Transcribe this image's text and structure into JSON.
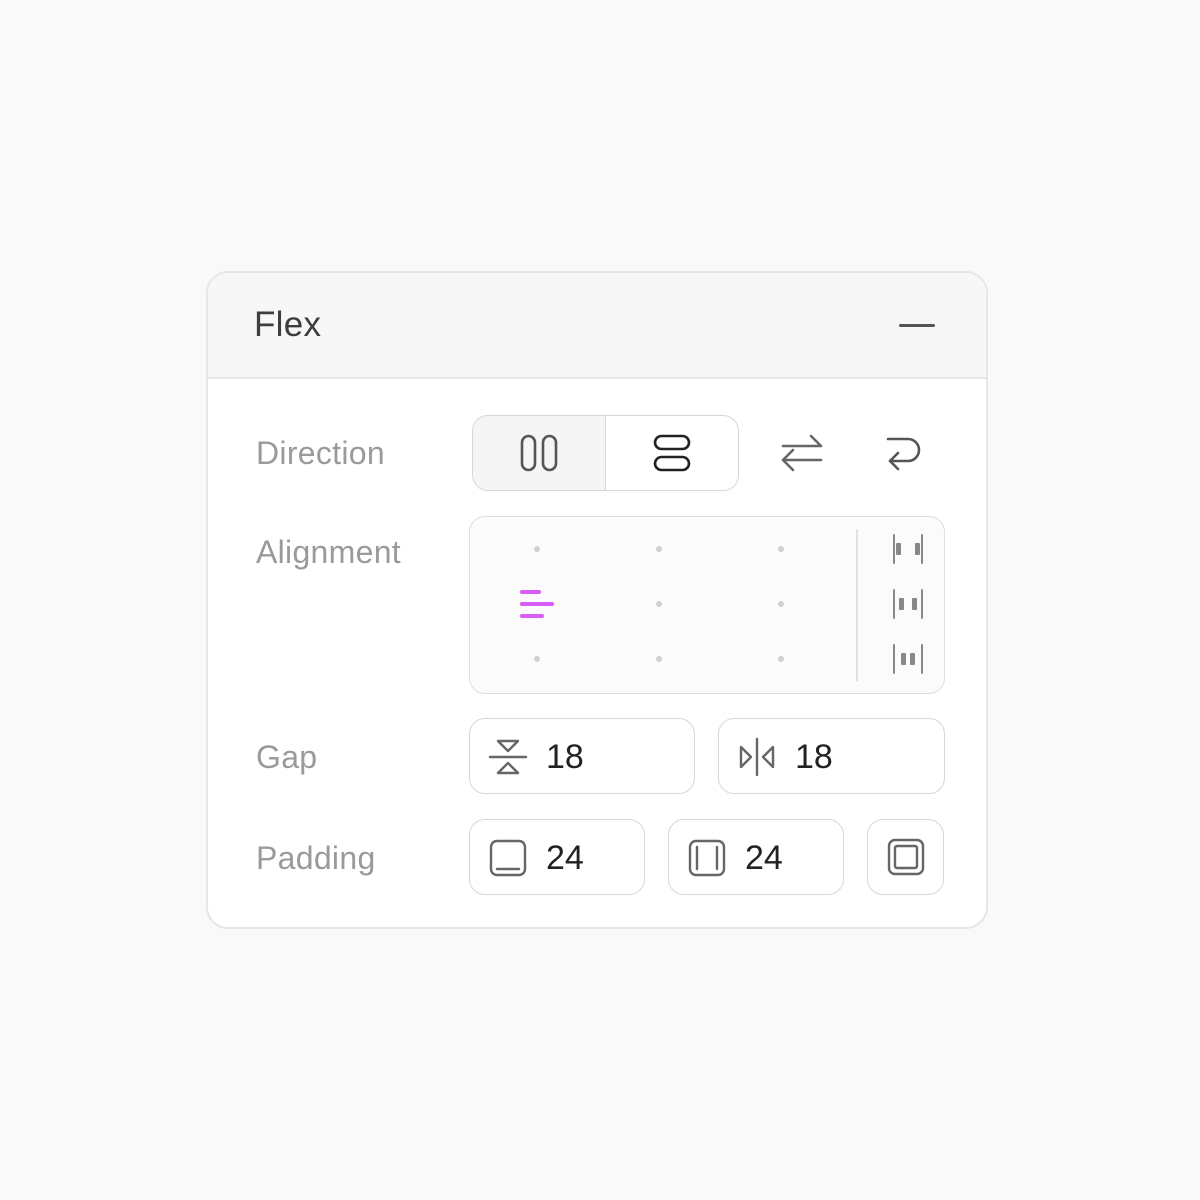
{
  "panel": {
    "title": "Flex",
    "collapse_icon": "minus-icon"
  },
  "direction": {
    "label": "Direction",
    "options": [
      {
        "name": "row",
        "icon": "columns-icon",
        "selected": true
      },
      {
        "name": "column",
        "icon": "rows-icon",
        "selected": false
      }
    ],
    "reverse_icon": "swap-arrows-icon",
    "wrap_icon": "wrap-arrow-icon"
  },
  "alignment": {
    "label": "Alignment",
    "selected_cell": "middle-left",
    "accent_color": "#d65cf5",
    "distribution_icons": [
      "space-between-icon",
      "space-around-icon",
      "space-evenly-icon"
    ]
  },
  "gap": {
    "label": "Gap",
    "row_value": "18",
    "column_value": "18"
  },
  "padding": {
    "label": "Padding",
    "vertical_value": "24",
    "horizontal_value": "24"
  },
  "colors": {
    "background": "#f9f9f9",
    "panel": "#ffffff",
    "border": "#e6e6e6",
    "label": "#9a9a9a",
    "icon": "#666666"
  }
}
